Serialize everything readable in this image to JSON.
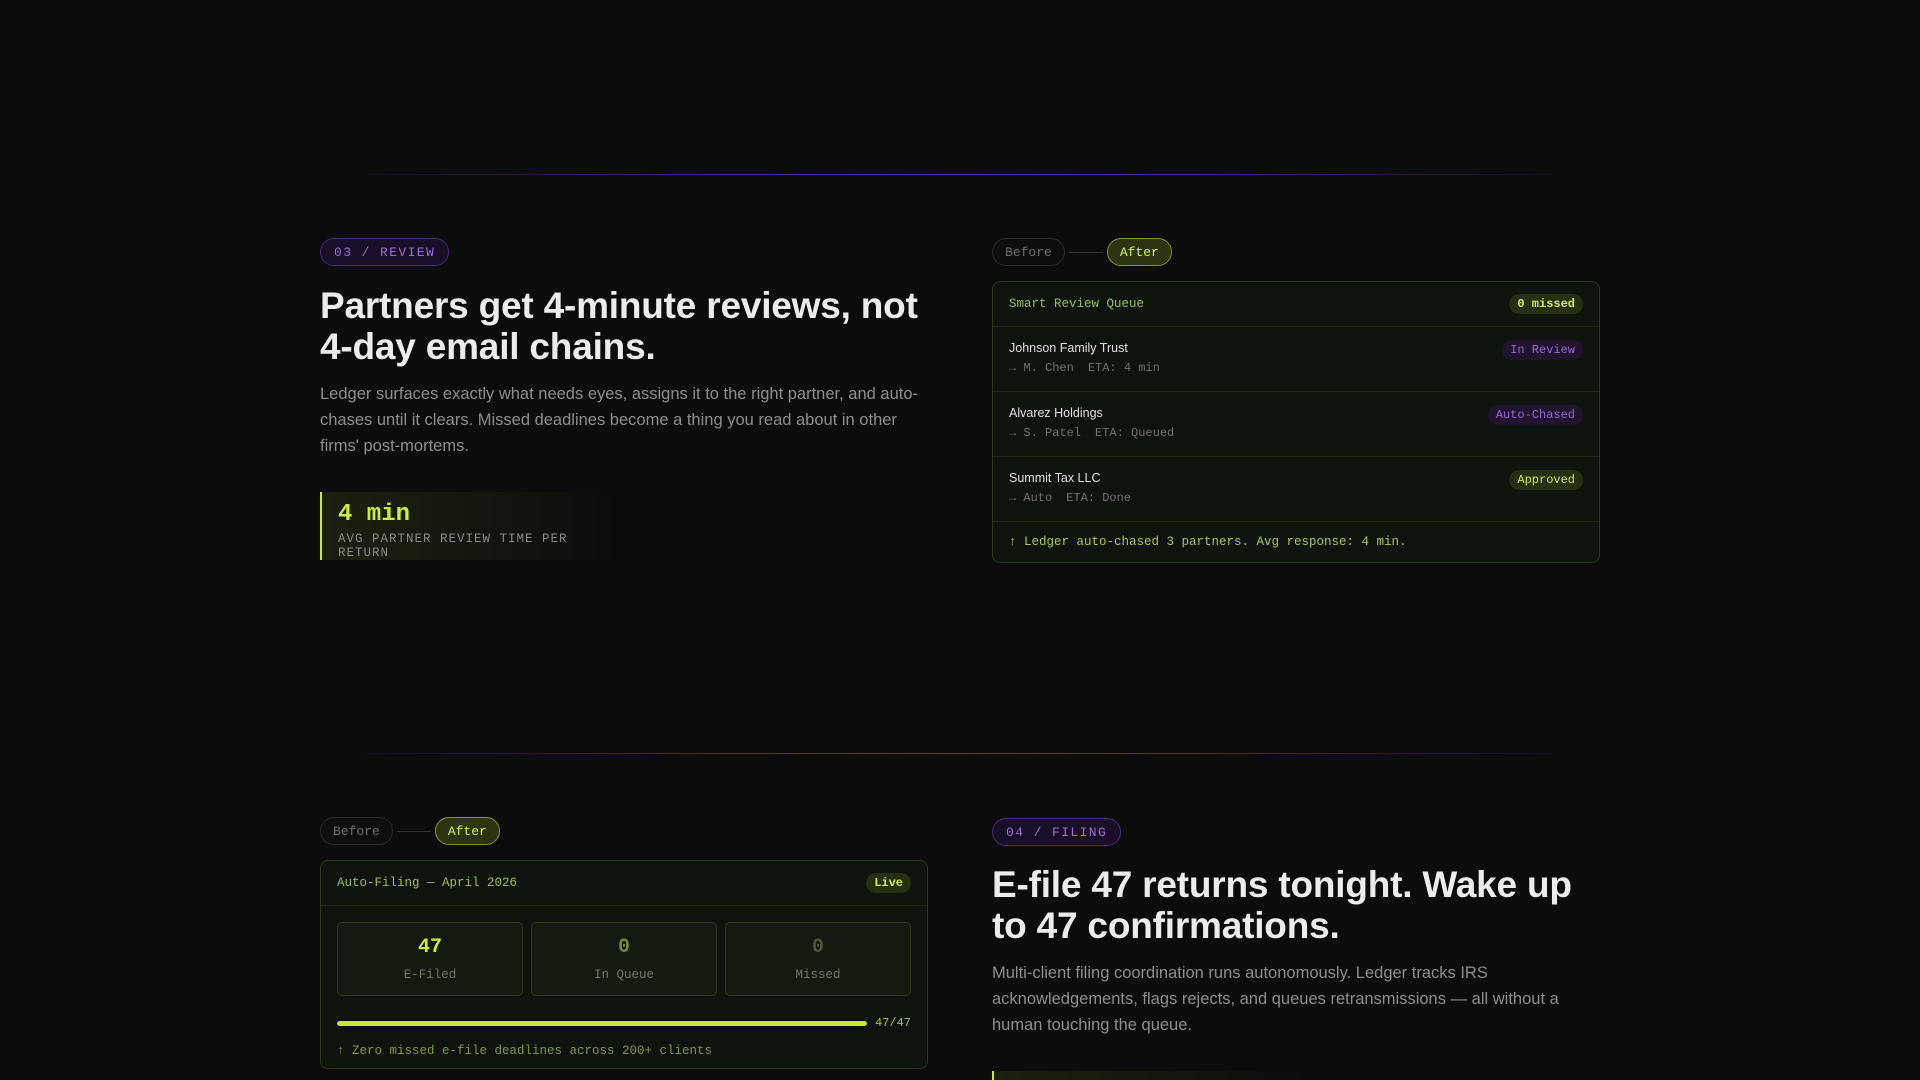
{
  "review": {
    "tag": "03 / REVIEW",
    "headline": "Partners get 4-minute reviews, not 4-day email chains.",
    "body": "Ledger surfaces exactly what needs eyes, assigns it to the right partner, and auto-chases until it clears. Missed deadlines become a thing you read about in other firms' post-mortems.",
    "stat_value": "4 min",
    "stat_label": "AVG PARTNER REVIEW TIME PER RETURN",
    "toggle": {
      "before": "Before",
      "after": "After"
    },
    "card": {
      "title": "Smart Review Queue",
      "badge": "0 missed",
      "rows": [
        {
          "name": "Johnson Family Trust",
          "assignee": "→ M. Chen",
          "eta": "ETA: 4 min",
          "status": "In Review"
        },
        {
          "name": "Alvarez Holdings",
          "assignee": "→ S. Patel",
          "eta": "ETA: Queued",
          "status": "Auto-Chased"
        },
        {
          "name": "Summit Tax LLC",
          "assignee": "→ Auto",
          "eta": "ETA: Done",
          "status": "Approved"
        }
      ],
      "footer": "↑ Ledger auto-chased 3 partners. Avg response: 4 min."
    }
  },
  "filing": {
    "tag": "04 / FILING",
    "headline": "E-file 47 returns tonight. Wake up to 47 confirmations.",
    "body": "Multi-client filing coordination runs autonomously. Ledger tracks IRS acknowledgements, flags rejects, and queues retransmissions — all without a human touching the queue.",
    "toggle": {
      "before": "Before",
      "after": "After"
    },
    "card": {
      "title": "Auto-Filing — April 2026",
      "badge": "Live",
      "tiles": [
        {
          "value": "47",
          "label": "E-Filed"
        },
        {
          "value": "0",
          "label": "In Queue"
        },
        {
          "value": "0",
          "label": "Missed"
        }
      ],
      "progress_fraction": 1.0,
      "progress_label": "47/47",
      "footer": "↑ Zero missed e-file deadlines across 200+ clients"
    }
  },
  "colors": {
    "accent": "#c6ea34",
    "purple": "#9b6dd6",
    "background": "#0c0c0c"
  }
}
